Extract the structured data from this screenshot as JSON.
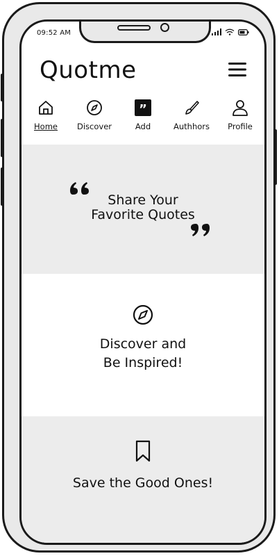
{
  "status_bar": {
    "time": "09:52 AM"
  },
  "header": {
    "title": "Quotme"
  },
  "nav": [
    {
      "label": "Home",
      "icon": "home-icon",
      "active": true
    },
    {
      "label": "Discover",
      "icon": "compass-icon",
      "active": false
    },
    {
      "label": "Add",
      "icon": "quote-icon",
      "active": false
    },
    {
      "label": "Authhors",
      "icon": "pen-icon",
      "active": false
    },
    {
      "label": "Profile",
      "icon": "user-icon",
      "active": false
    }
  ],
  "hero": {
    "line1": "Share Your",
    "line2": "Favorite Quotes"
  },
  "discover": {
    "line1": "Discover and",
    "line2": "Be Inspired!"
  },
  "save": {
    "text": "Save the Good Ones!"
  }
}
